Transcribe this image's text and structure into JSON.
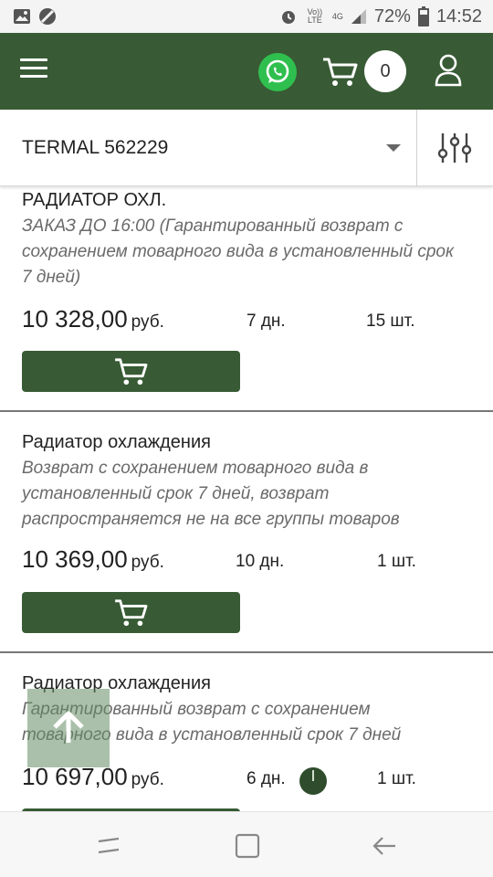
{
  "status_bar": {
    "left_icons": [
      "image-icon",
      "blocked-icon"
    ],
    "right_icons": [
      "alarm-icon",
      "volte-icon",
      "4g-icon",
      "signal-icon",
      "battery-icon"
    ],
    "volte_text": "Vo)) LTE",
    "network_text": "4G",
    "battery": "72%",
    "time": "14:52"
  },
  "app_bar": {
    "menu_icon": "hamburger-icon",
    "whatsapp_icon": "whatsapp-icon",
    "cart_icon": "cart-icon",
    "cart_count": "0",
    "user_icon": "user-icon",
    "bg_color": "#385b35"
  },
  "filter_bar": {
    "search_value": "TERMAL 562229",
    "filter_icon": "sliders-icon"
  },
  "items": [
    {
      "title": "РАДИАТОР ОХЛ.",
      "note": "ЗАКАЗ ДО 16:00 (Гарантированный возврат с сохранением товарного вида в установленный срок 7 дней)",
      "price": "10 328,00",
      "currency": "руб.",
      "days": "7 дн.",
      "qty": "15 шт."
    },
    {
      "title": "Радиатор охлаждения",
      "note": "Возврат с сохранением товарного вида в установленный срок 7 дней, возврат распространяется не на все группы товаров",
      "price": "10 369,00",
      "currency": "руб.",
      "days": "10 дн.",
      "qty": "1 шт."
    },
    {
      "title": "Радиатор охлаждения",
      "note": "Гарантированный возврат с сохранением товарного вида в установленный срок 7 дней",
      "price": "10 697,00",
      "currency": "руб.",
      "days": "6 дн.",
      "qty": "1 шт."
    }
  ],
  "floating": {
    "scroll_top_icon": "arrow-up-icon",
    "loader_icon": "loading-indicator"
  },
  "nav_bar": {
    "icons": [
      "recents-icon",
      "home-icon",
      "back-icon"
    ]
  }
}
